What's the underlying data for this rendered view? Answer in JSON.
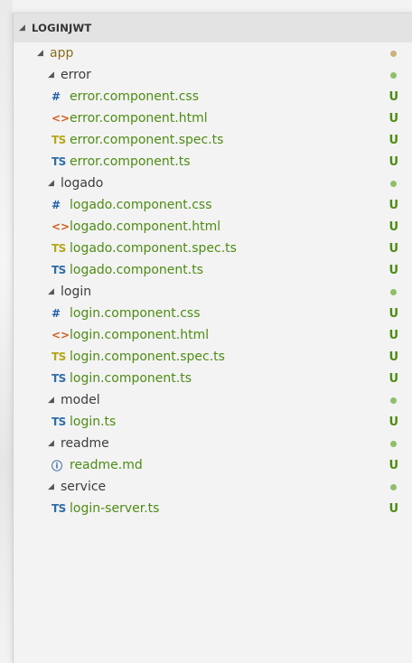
{
  "explorer": {
    "section_title": "LOGINJWT",
    "section_twisty": "◢",
    "rows": [
      {
        "kind": "folder",
        "name": "app",
        "level": 1,
        "status": "dot",
        "dot_color": "tan"
      },
      {
        "kind": "folder",
        "name": "error",
        "level": 2,
        "status": "dot",
        "dot_color": "green"
      },
      {
        "kind": "file",
        "icon": "#",
        "icon_type": "css",
        "name": "error.component.css",
        "level": 3,
        "status": "U"
      },
      {
        "kind": "file",
        "icon": "<>",
        "icon_type": "html",
        "name": "error.component.html",
        "level": 3,
        "status": "U"
      },
      {
        "kind": "file",
        "icon": "TS",
        "icon_type": "spec",
        "name": "error.component.spec.ts",
        "level": 3,
        "status": "U"
      },
      {
        "kind": "file",
        "icon": "TS",
        "icon_type": "ts",
        "name": "error.component.ts",
        "level": 3,
        "status": "U"
      },
      {
        "kind": "folder",
        "name": "logado",
        "level": 2,
        "status": "dot",
        "dot_color": "green"
      },
      {
        "kind": "file",
        "icon": "#",
        "icon_type": "css",
        "name": "logado.component.css",
        "level": 3,
        "status": "U"
      },
      {
        "kind": "file",
        "icon": "<>",
        "icon_type": "html",
        "name": "logado.component.html",
        "level": 3,
        "status": "U"
      },
      {
        "kind": "file",
        "icon": "TS",
        "icon_type": "spec",
        "name": "logado.component.spec.ts",
        "level": 3,
        "status": "U"
      },
      {
        "kind": "file",
        "icon": "TS",
        "icon_type": "ts",
        "name": "logado.component.ts",
        "level": 3,
        "status": "U"
      },
      {
        "kind": "folder",
        "name": "login",
        "level": 2,
        "status": "dot",
        "dot_color": "green"
      },
      {
        "kind": "file",
        "icon": "#",
        "icon_type": "css",
        "name": "login.component.css",
        "level": 3,
        "status": "U"
      },
      {
        "kind": "file",
        "icon": "<>",
        "icon_type": "html",
        "name": "login.component.html",
        "level": 3,
        "status": "U"
      },
      {
        "kind": "file",
        "icon": "TS",
        "icon_type": "spec",
        "name": "login.component.spec.ts",
        "level": 3,
        "status": "U"
      },
      {
        "kind": "file",
        "icon": "TS",
        "icon_type": "ts",
        "name": "login.component.ts",
        "level": 3,
        "status": "U"
      },
      {
        "kind": "folder",
        "name": "model",
        "level": 2,
        "status": "dot",
        "dot_color": "green"
      },
      {
        "kind": "file",
        "icon": "TS",
        "icon_type": "ts",
        "name": "login.ts",
        "level": 3,
        "status": "U"
      },
      {
        "kind": "folder",
        "name": "readme",
        "level": 2,
        "status": "dot",
        "dot_color": "green"
      },
      {
        "kind": "file",
        "icon": "ⓘ",
        "icon_type": "info",
        "name": "readme.md",
        "level": 3,
        "status": "U"
      },
      {
        "kind": "folder",
        "name": "service",
        "level": 2,
        "status": "dot",
        "dot_color": "green"
      },
      {
        "kind": "file",
        "icon": "TS",
        "icon_type": "ts",
        "name": "login-server.ts",
        "level": 3,
        "status": "U"
      }
    ],
    "folder_twisty": "◢"
  }
}
